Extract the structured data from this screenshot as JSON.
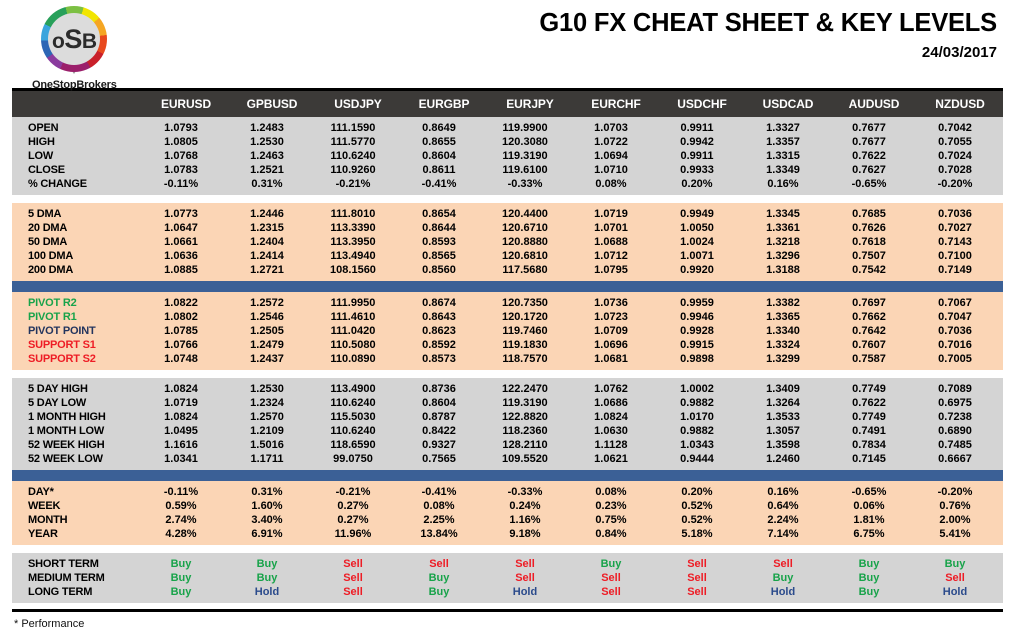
{
  "header": {
    "logo": {
      "mark": "oSb",
      "brand_name": "OneStopBrokers"
    },
    "title": "G10 FX CHEAT SHEET & KEY LEVELS",
    "date": "24/03/2017"
  },
  "colors": {
    "header_bar": "#3C3A38",
    "separator_bar": "#3B6096",
    "block_gray": "#D4D4D4",
    "block_peach": "#FBD5B5",
    "buy": "#18A34A",
    "sell": "#EE1C25",
    "hold": "#2B4B8C",
    "pivot_resistance": "#18A34A",
    "pivot_point": "#23355E",
    "support": "#EE1C25"
  },
  "table": {
    "corner_label": "",
    "columns": [
      "EURUSD",
      "GPBUSD",
      "USDJPY",
      "EURGBP",
      "EURJPY",
      "EURCHF",
      "USDCHF",
      "USDCAD",
      "AUDUSD",
      "NZDUSD"
    ],
    "blocks": [
      {
        "id": "ohlc",
        "style": "gray",
        "rows": [
          {
            "label": "OPEN",
            "label_color": "black",
            "values": [
              "1.0793",
              "1.2483",
              "111.1590",
              "0.8649",
              "119.9900",
              "1.0703",
              "0.9911",
              "1.3327",
              "0.7677",
              "0.7042"
            ]
          },
          {
            "label": "HIGH",
            "label_color": "black",
            "values": [
              "1.0805",
              "1.2530",
              "111.5770",
              "0.8655",
              "120.3080",
              "1.0722",
              "0.9942",
              "1.3357",
              "0.7677",
              "0.7055"
            ]
          },
          {
            "label": "LOW",
            "label_color": "black",
            "values": [
              "1.0768",
              "1.2463",
              "110.6240",
              "0.8604",
              "119.3190",
              "1.0694",
              "0.9911",
              "1.3315",
              "0.7622",
              "0.7024"
            ]
          },
          {
            "label": "CLOSE",
            "label_color": "black",
            "values": [
              "1.0783",
              "1.2521",
              "110.9260",
              "0.8611",
              "119.6100",
              "1.0710",
              "0.9933",
              "1.3349",
              "0.7627",
              "0.7028"
            ]
          },
          {
            "label": "% CHANGE",
            "label_color": "black",
            "values": [
              "-0.11%",
              "0.31%",
              "-0.21%",
              "-0.41%",
              "-0.33%",
              "0.08%",
              "0.20%",
              "0.16%",
              "-0.65%",
              "-0.20%"
            ]
          }
        ]
      },
      {
        "id": "moving-averages",
        "style": "peach",
        "rows": [
          {
            "label": "5 DMA",
            "label_color": "black",
            "values": [
              "1.0773",
              "1.2446",
              "111.8010",
              "0.8654",
              "120.4400",
              "1.0719",
              "0.9949",
              "1.3345",
              "0.7685",
              "0.7036"
            ]
          },
          {
            "label": "20 DMA",
            "label_color": "black",
            "values": [
              "1.0647",
              "1.2315",
              "113.3390",
              "0.8644",
              "120.6710",
              "1.0701",
              "1.0050",
              "1.3361",
              "0.7626",
              "0.7027"
            ]
          },
          {
            "label": "50 DMA",
            "label_color": "black",
            "values": [
              "1.0661",
              "1.2404",
              "113.3950",
              "0.8593",
              "120.8880",
              "1.0688",
              "1.0024",
              "1.3218",
              "0.7618",
              "0.7143"
            ]
          },
          {
            "label": "100 DMA",
            "label_color": "black",
            "values": [
              "1.0636",
              "1.2414",
              "113.4940",
              "0.8565",
              "120.6810",
              "1.0712",
              "1.0071",
              "1.3296",
              "0.7507",
              "0.7100"
            ]
          },
          {
            "label": "200 DMA",
            "label_color": "black",
            "values": [
              "1.0885",
              "1.2721",
              "108.1560",
              "0.8560",
              "117.5680",
              "1.0795",
              "0.9920",
              "1.3188",
              "0.7542",
              "0.7149"
            ]
          }
        ]
      },
      {
        "id": "pivots",
        "style": "peach",
        "rows": [
          {
            "label": "PIVOT R2",
            "label_color": "green",
            "values": [
              "1.0822",
              "1.2572",
              "111.9950",
              "0.8674",
              "120.7350",
              "1.0736",
              "0.9959",
              "1.3382",
              "0.7697",
              "0.7067"
            ]
          },
          {
            "label": "PIVOT R1",
            "label_color": "green",
            "values": [
              "1.0802",
              "1.2546",
              "111.4610",
              "0.8643",
              "120.1720",
              "1.0723",
              "0.9946",
              "1.3365",
              "0.7662",
              "0.7047"
            ]
          },
          {
            "label": "PIVOT POINT",
            "label_color": "navy",
            "values": [
              "1.0785",
              "1.2505",
              "111.0420",
              "0.8623",
              "119.7460",
              "1.0709",
              "0.9928",
              "1.3340",
              "0.7642",
              "0.7036"
            ]
          },
          {
            "label": "SUPPORT S1",
            "label_color": "red",
            "values": [
              "1.0766",
              "1.2479",
              "110.5080",
              "0.8592",
              "119.1830",
              "1.0696",
              "0.9915",
              "1.3324",
              "0.7607",
              "0.7016"
            ]
          },
          {
            "label": "SUPPORT S2",
            "label_color": "red",
            "values": [
              "1.0748",
              "1.2437",
              "110.0890",
              "0.8573",
              "118.7570",
              "1.0681",
              "0.9898",
              "1.3299",
              "0.7587",
              "0.7005"
            ]
          }
        ]
      },
      {
        "id": "ranges",
        "style": "gray",
        "rows": [
          {
            "label": "5 DAY HIGH",
            "label_color": "black",
            "values": [
              "1.0824",
              "1.2530",
              "113.4900",
              "0.8736",
              "122.2470",
              "1.0762",
              "1.0002",
              "1.3409",
              "0.7749",
              "0.7089"
            ]
          },
          {
            "label": "5 DAY LOW",
            "label_color": "black",
            "values": [
              "1.0719",
              "1.2324",
              "110.6240",
              "0.8604",
              "119.3190",
              "1.0686",
              "0.9882",
              "1.3264",
              "0.7622",
              "0.6975"
            ]
          },
          {
            "label": "1 MONTH HIGH",
            "label_color": "black",
            "values": [
              "1.0824",
              "1.2570",
              "115.5030",
              "0.8787",
              "122.8820",
              "1.0824",
              "1.0170",
              "1.3533",
              "0.7749",
              "0.7238"
            ]
          },
          {
            "label": "1 MONTH LOW",
            "label_color": "black",
            "values": [
              "1.0495",
              "1.2109",
              "110.6240",
              "0.8422",
              "118.2360",
              "1.0630",
              "0.9882",
              "1.3057",
              "0.7491",
              "0.6890"
            ]
          },
          {
            "label": "52 WEEK HIGH",
            "label_color": "black",
            "values": [
              "1.1616",
              "1.5016",
              "118.6590",
              "0.9327",
              "128.2110",
              "1.1128",
              "1.0343",
              "1.3598",
              "0.7834",
              "0.7485"
            ]
          },
          {
            "label": "52 WEEK LOW",
            "label_color": "black",
            "values": [
              "1.0341",
              "1.1711",
              "99.0750",
              "0.7565",
              "109.5520",
              "1.0621",
              "0.9444",
              "1.2460",
              "0.7145",
              "0.6667"
            ]
          }
        ]
      },
      {
        "id": "performance",
        "style": "peach",
        "rows": [
          {
            "label": "DAY*",
            "label_color": "black",
            "values": [
              "-0.11%",
              "0.31%",
              "-0.21%",
              "-0.41%",
              "-0.33%",
              "0.08%",
              "0.20%",
              "0.16%",
              "-0.65%",
              "-0.20%"
            ]
          },
          {
            "label": "WEEK",
            "label_color": "black",
            "values": [
              "0.59%",
              "1.60%",
              "0.27%",
              "0.08%",
              "0.24%",
              "0.23%",
              "0.52%",
              "0.64%",
              "0.06%",
              "0.76%"
            ]
          },
          {
            "label": "MONTH",
            "label_color": "black",
            "values": [
              "2.74%",
              "3.40%",
              "0.27%",
              "2.25%",
              "1.16%",
              "0.75%",
              "0.52%",
              "2.24%",
              "1.81%",
              "2.00%"
            ]
          },
          {
            "label": "YEAR",
            "label_color": "black",
            "values": [
              "4.28%",
              "6.91%",
              "11.96%",
              "13.84%",
              "9.18%",
              "0.84%",
              "5.18%",
              "7.14%",
              "6.75%",
              "5.41%"
            ]
          }
        ]
      },
      {
        "id": "signals",
        "style": "gray",
        "signal_block": true,
        "rows": [
          {
            "label": "SHORT TERM",
            "label_color": "black",
            "values": [
              "Buy",
              "Buy",
              "Sell",
              "Sell",
              "Sell",
              "Buy",
              "Sell",
              "Sell",
              "Buy",
              "Buy"
            ]
          },
          {
            "label": "MEDIUM TERM",
            "label_color": "black",
            "values": [
              "Buy",
              "Buy",
              "Sell",
              "Buy",
              "Sell",
              "Sell",
              "Sell",
              "Buy",
              "Buy",
              "Sell"
            ]
          },
          {
            "label": "LONG TERM",
            "label_color": "black",
            "values": [
              "Buy",
              "Hold",
              "Sell",
              "Buy",
              "Hold",
              "Sell",
              "Sell",
              "Hold",
              "Buy",
              "Hold"
            ]
          }
        ]
      }
    ]
  },
  "footer": {
    "note": "* Performance"
  }
}
